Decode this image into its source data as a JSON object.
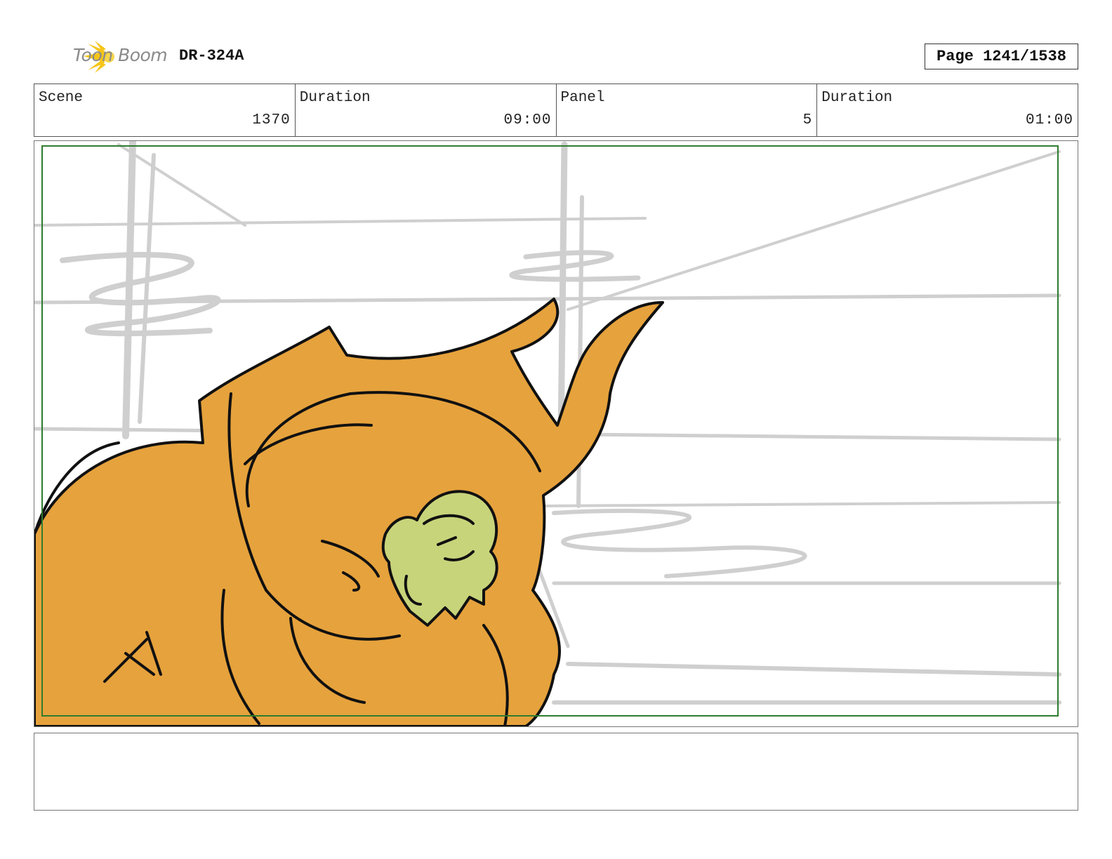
{
  "header": {
    "logo_text": "Toon Boom",
    "doc_id": "DR-324A",
    "page_label": "Page 1241/1538"
  },
  "info": {
    "scene_label": "Scene",
    "scene_value": "1370",
    "scene_duration_label": "Duration",
    "scene_duration_value": "09:00",
    "panel_label": "Panel",
    "panel_value": "5",
    "panel_duration_label": "Duration",
    "panel_duration_value": "01:00"
  },
  "colors": {
    "safe_frame": "#2e7d2e",
    "character_fill": "#e6a23c",
    "small_character_fill": "#c8d47a",
    "background_lines": "#cfcfcf",
    "logo_star": "#f5c518"
  },
  "notes": {
    "text": ""
  }
}
